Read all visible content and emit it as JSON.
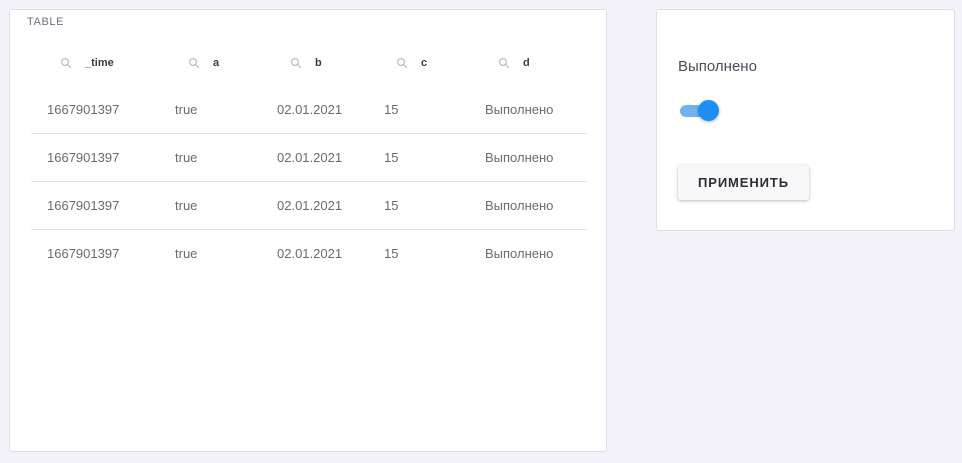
{
  "table_panel": {
    "title": "TABLE",
    "columns": [
      "_time",
      "a",
      "b",
      "c",
      "d"
    ],
    "rows": [
      [
        "1667901397",
        "true",
        "02.01.2021",
        "15",
        "Выполнено"
      ],
      [
        "1667901397",
        "true",
        "02.01.2021",
        "15",
        "Выполнено"
      ],
      [
        "1667901397",
        "true",
        "02.01.2021",
        "15",
        "Выполнено"
      ],
      [
        "1667901397",
        "true",
        "02.01.2021",
        "15",
        "Выполнено"
      ]
    ]
  },
  "control_panel": {
    "label": "Выполнено",
    "toggle_on": true,
    "apply_label": "ПРИМЕНИТЬ"
  },
  "colors": {
    "accent": "#1e8ff2",
    "track": "#6fb4ee",
    "background": "#f3f3f9"
  },
  "icons": {
    "column_search": "search-icon"
  }
}
